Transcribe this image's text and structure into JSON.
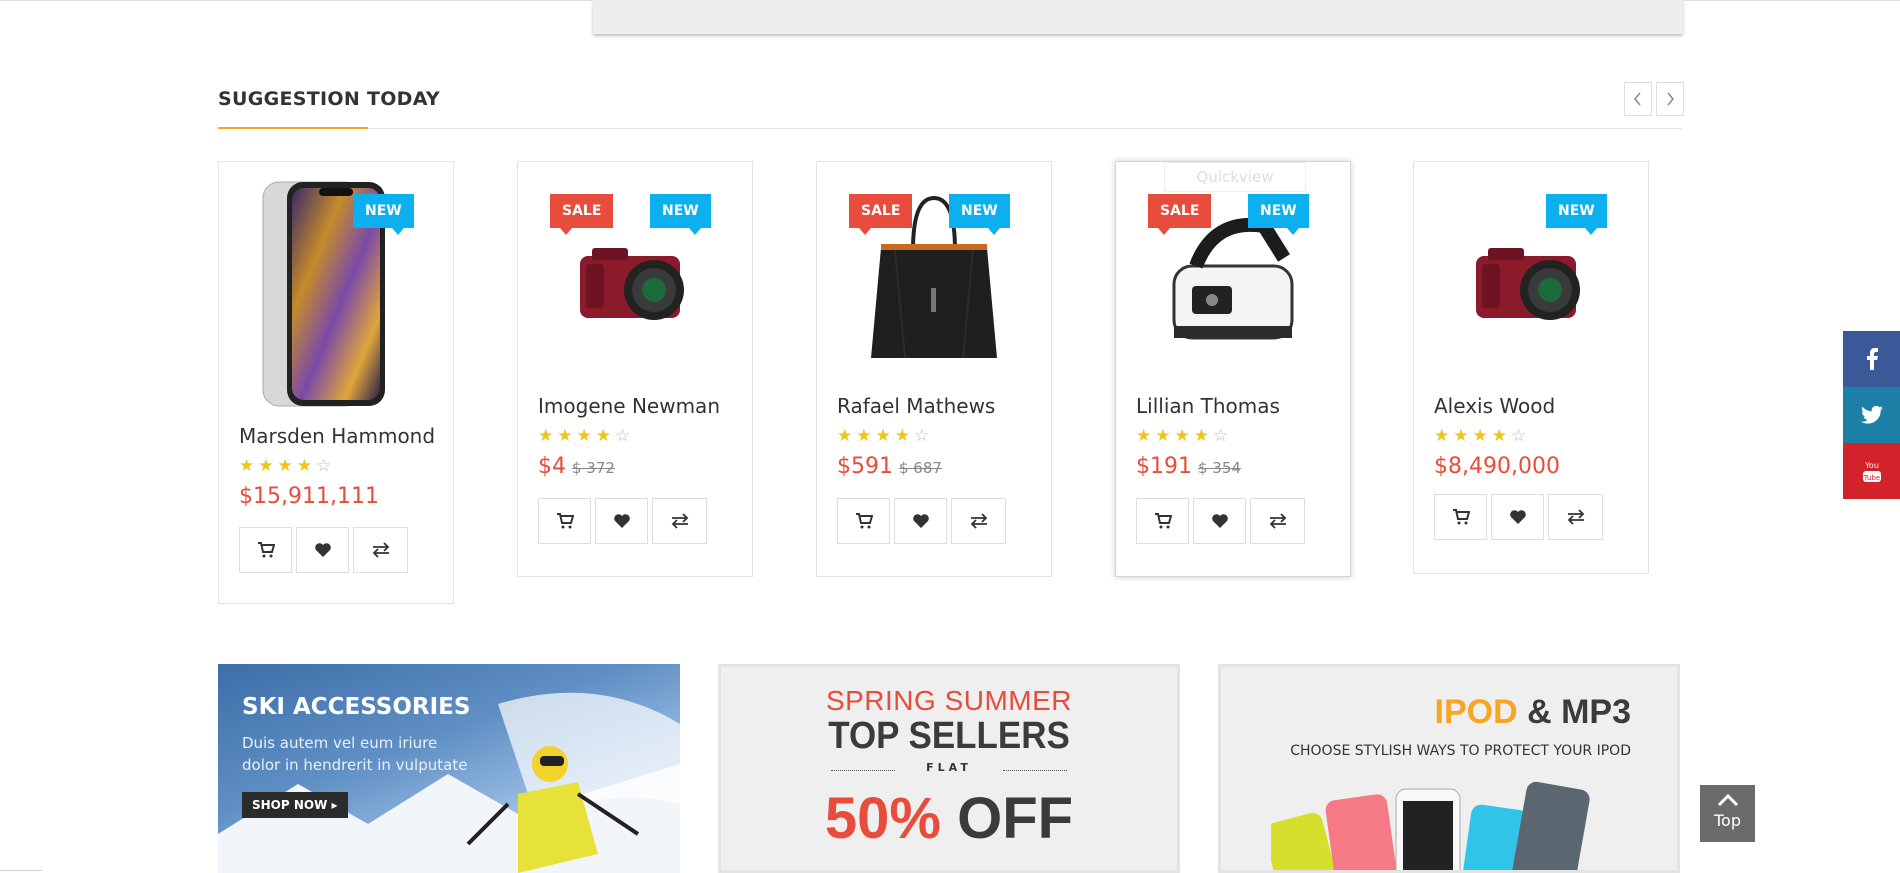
{
  "section": {
    "title": "SUGGESTION TODAY",
    "prev_icon": "chevron-left-icon",
    "next_icon": "chevron-right-icon"
  },
  "products": [
    {
      "name": "Marsden Hammond",
      "rating": 4,
      "price": "$15,911,111",
      "old_price": "",
      "badges": [
        "NEW"
      ],
      "image": "smartphone"
    },
    {
      "name": "Imogene Newman",
      "rating": 4,
      "price": "$4",
      "old_price": "$ 372",
      "badges": [
        "SALE",
        "NEW"
      ],
      "image": "camera"
    },
    {
      "name": "Rafael Mathews",
      "rating": 4,
      "price": "$591",
      "old_price": "$ 687",
      "badges": [
        "SALE",
        "NEW"
      ],
      "image": "handbag"
    },
    {
      "name": "Lillian Thomas",
      "rating": 4,
      "price": "$191",
      "old_price": "$ 354",
      "badges": [
        "SALE",
        "NEW"
      ],
      "image": "steam-iron",
      "quickview": "Quickview"
    },
    {
      "name": "Alexis Wood",
      "rating": 4,
      "price": "$8,490,000",
      "old_price": "",
      "badges": [
        "NEW"
      ],
      "image": "camera"
    }
  ],
  "banners": {
    "ski": {
      "title": "SKI ACCESSORIES",
      "text_line1": "Duis autem vel eum iriure",
      "text_line2": "dolor in hendrerit in vulputate",
      "button": "SHOP NOW"
    },
    "spring": {
      "line1": "SPRING SUMMER",
      "line2": "TOP SELLERS",
      "flat": "FLAT",
      "percent": "50%",
      "off": "OFF"
    },
    "ipod": {
      "title_colored": "IPOD",
      "title_rest": "& MP3",
      "subtitle": "CHOOSE STYLISH WAYS TO PROTECT YOUR IPOD"
    }
  },
  "social": [
    {
      "name": "facebook",
      "color": "#3b5998",
      "icon": "facebook-icon"
    },
    {
      "name": "twitter",
      "color": "#1b7fa6",
      "icon": "twitter-icon"
    },
    {
      "name": "youtube",
      "color": "#d2232a",
      "icon": "youtube-icon"
    }
  ],
  "to_top": {
    "label": "Top"
  },
  "colors": {
    "accent": "#f5a623",
    "price": "#e74c3c",
    "new_badge": "#0db0ee",
    "sale_badge": "#e74c3c",
    "star": "#f0c419"
  }
}
